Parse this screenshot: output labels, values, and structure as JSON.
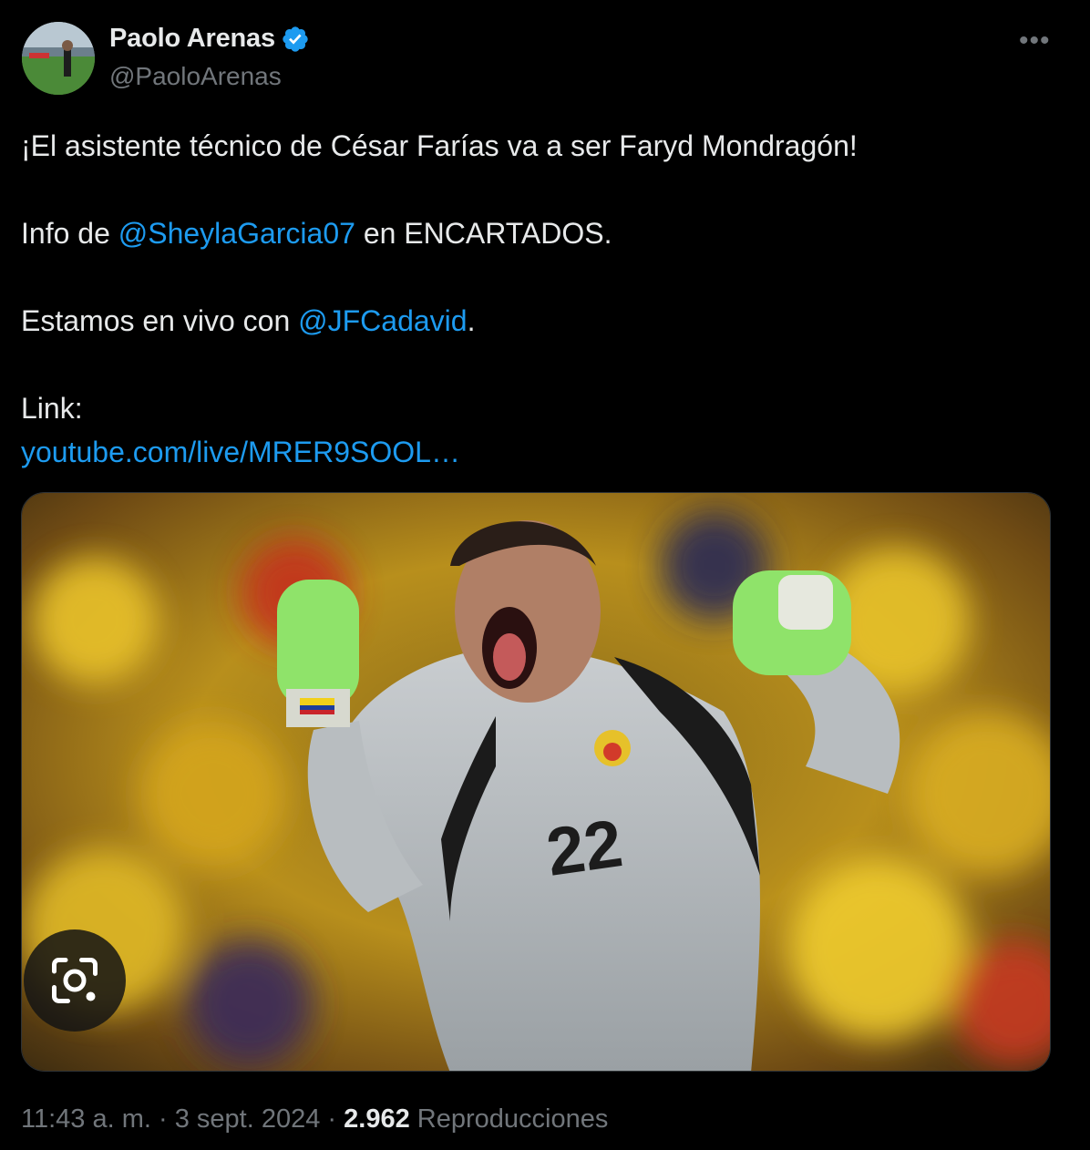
{
  "author": {
    "name": "Paolo Arenas",
    "handle": "@PaoloArenas",
    "verified": true
  },
  "tweet": {
    "line1": "¡El asistente técnico de César Farías va a ser Faryd Mondragón!",
    "line2_prefix": "Info de ",
    "line2_mention": "@SheylaGarcia07",
    "line2_suffix": " en ENCARTADOS.",
    "line3_prefix": "Estamos en vivo con ",
    "line3_mention": "@JFCadavid",
    "line3_suffix": ".",
    "line4": "Link:",
    "link_text": "youtube.com/live/MRER9SOOL…"
  },
  "media": {
    "jersey_number": "22"
  },
  "meta": {
    "time": "11:43 a. m.",
    "separator": " · ",
    "date": "3 sept. 2024",
    "views_count": "2.962",
    "views_label": "Reproducciones"
  },
  "icons": {
    "more": "more-icon",
    "verified": "verified-badge-icon",
    "lens": "google-lens-icon"
  },
  "colors": {
    "background": "#000000",
    "text": "#e7e9ea",
    "secondary": "#71767b",
    "link": "#1d9bf0",
    "verified": "#1d9bf0"
  }
}
